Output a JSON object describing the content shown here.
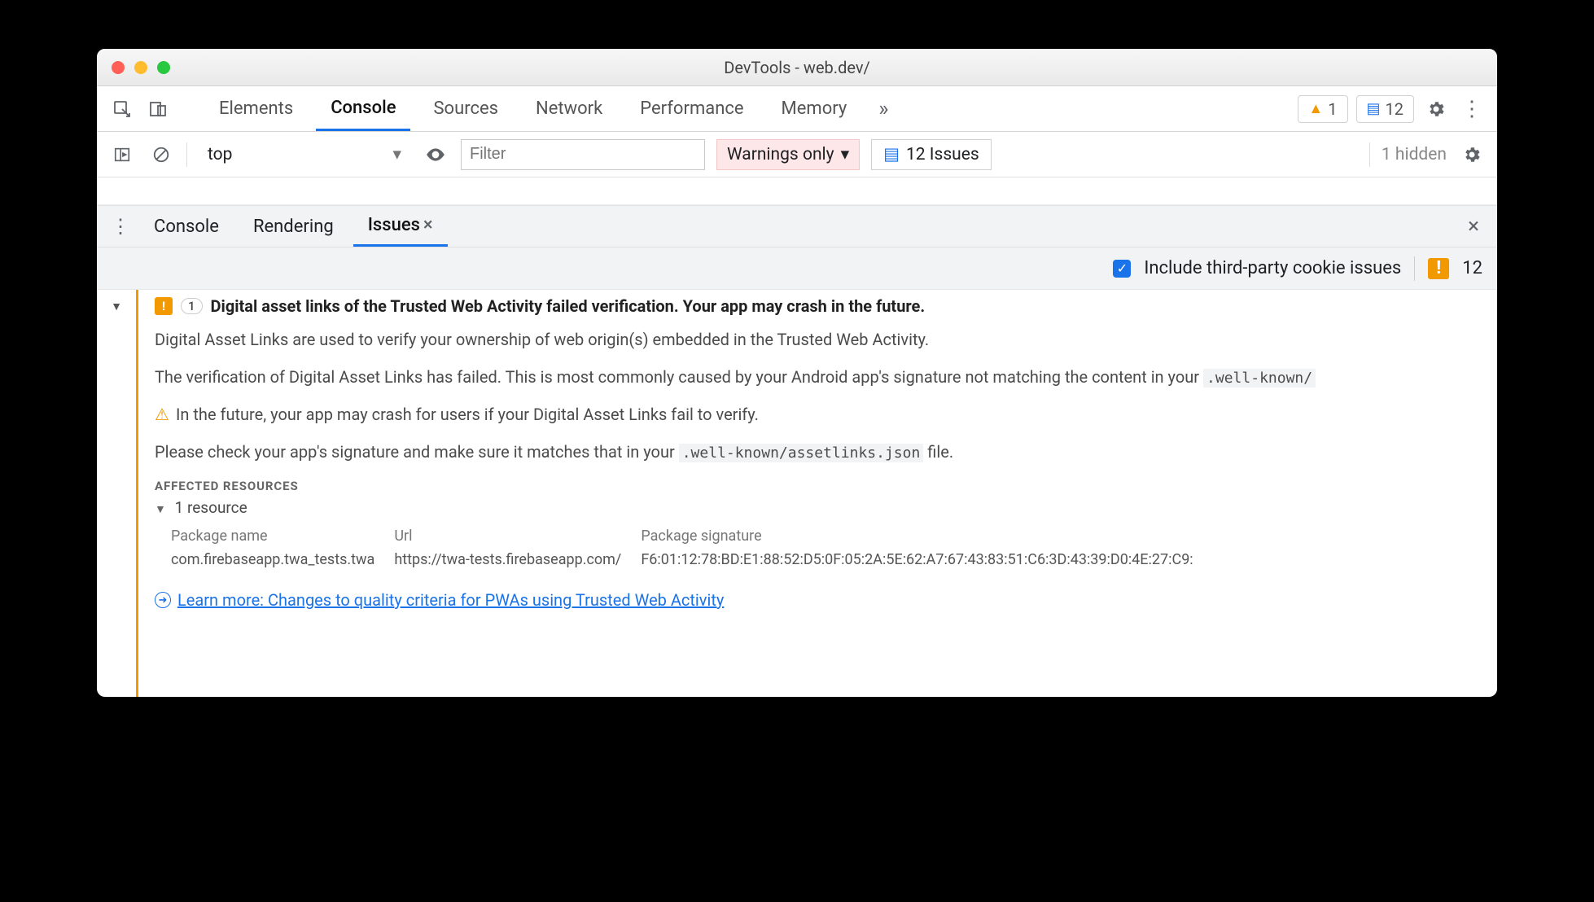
{
  "window": {
    "title": "DevTools - web.dev/"
  },
  "main_tabs": {
    "items": [
      "Elements",
      "Console",
      "Sources",
      "Network",
      "Performance",
      "Memory"
    ],
    "active": "Console"
  },
  "badges": {
    "warnings": "1",
    "messages": "12"
  },
  "filterbar": {
    "context": "top",
    "filter_placeholder": "Filter",
    "level": "Warnings only",
    "issues_label": "12 Issues",
    "hidden": "1 hidden"
  },
  "drawer_tabs": {
    "items": [
      "Console",
      "Rendering",
      "Issues"
    ],
    "active": "Issues"
  },
  "issues_toolbar": {
    "third_party_label": "Include third-party cookie issues",
    "third_party_checked": true,
    "total": "12"
  },
  "issue": {
    "count": "1",
    "title": "Digital asset links of the Trusted Web Activity failed verification. Your app may crash in the future.",
    "p1": "Digital Asset Links are used to verify your ownership of web origin(s) embedded in the Trusted Web Activity.",
    "p2_pre": "The verification of Digital Asset Links has failed. This is most commonly caused by your Android app's signature not matching the content in your ",
    "p2_code": ".well-known/",
    "p3": "In the future, your app may crash for users if your Digital Asset Links fail to verify.",
    "p4_pre": "Please check your app's signature and make sure it matches that in your ",
    "p4_code": ".well-known/assetlinks.json",
    "p4_post": " file.",
    "affected_label": "Affected Resources",
    "resource_count_label": "1 resource",
    "table": {
      "headers": [
        "Package name",
        "Url",
        "Package signature"
      ],
      "row": [
        "com.firebaseapp.twa_tests.twa",
        "https://twa-tests.firebaseapp.com/",
        "F6:01:12:78:BD:E1:88:52:D5:0F:05:2A:5E:62:A7:67:43:83:51:C6:3D:43:39:D0:4E:27:C9:"
      ]
    },
    "learn_more": "Learn more: Changes to quality criteria for PWAs using Trusted Web Activity"
  }
}
